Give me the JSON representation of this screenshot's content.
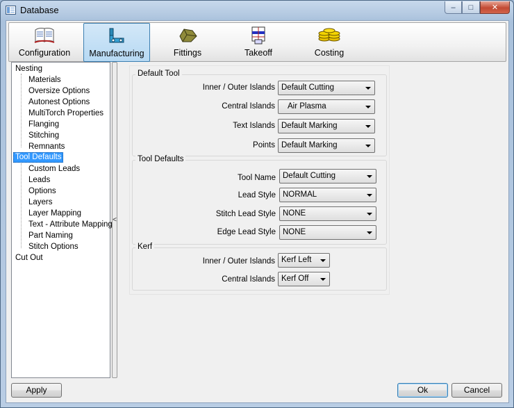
{
  "window": {
    "title": "Database"
  },
  "toolbar": {
    "items": [
      {
        "label": "Configuration",
        "icon": "configuration-icon"
      },
      {
        "label": "Manufacturing",
        "icon": "manufacturing-icon"
      },
      {
        "label": "Fittings",
        "icon": "fittings-icon"
      },
      {
        "label": "Takeoff",
        "icon": "takeoff-icon"
      },
      {
        "label": "Costing",
        "icon": "costing-icon"
      }
    ],
    "active": "Manufacturing"
  },
  "tree": {
    "items": [
      {
        "label": "Nesting"
      },
      {
        "label": "Materials"
      },
      {
        "label": "Oversize Options"
      },
      {
        "label": "Autonest Options"
      },
      {
        "label": "MultiTorch Properties"
      },
      {
        "label": "Flanging"
      },
      {
        "label": "Stitching"
      },
      {
        "label": "Remnants"
      },
      {
        "label": "Tool Defaults"
      },
      {
        "label": "Custom Leads"
      },
      {
        "label": "Leads"
      },
      {
        "label": "Options"
      },
      {
        "label": "Layers"
      },
      {
        "label": "Layer Mapping"
      },
      {
        "label": "Text - Attribute Mapping"
      },
      {
        "label": "Part Naming"
      },
      {
        "label": "Stitch Options"
      },
      {
        "label": "Cut Out"
      }
    ],
    "selected": "Tool Defaults"
  },
  "splitter": {
    "glyph": "<"
  },
  "default_tool": {
    "title": "Default Tool",
    "fields": [
      {
        "label": "Inner / Outer Islands",
        "value": "Default Cutting"
      },
      {
        "label": "Central Islands",
        "value": "Air Plasma"
      },
      {
        "label": "Text Islands",
        "value": "Default Marking"
      },
      {
        "label": "Points",
        "value": "Default Marking"
      }
    ]
  },
  "tool_defaults": {
    "title": "Tool Defaults",
    "fields": [
      {
        "label": "Tool Name",
        "value": "Default Cutting"
      },
      {
        "label": "Lead Style",
        "value": "NORMAL"
      },
      {
        "label": "Stitch Lead Style",
        "value": "NONE"
      },
      {
        "label": "Edge Lead Style",
        "value": "NONE"
      }
    ]
  },
  "kerf": {
    "title": "Kerf",
    "fields": [
      {
        "label": "Inner / Outer Islands",
        "value": "Kerf Left"
      },
      {
        "label": "Central Islands",
        "value": "Kerf Off"
      }
    ]
  },
  "buttons": {
    "apply": "Apply",
    "ok": "Ok",
    "cancel": "Cancel"
  }
}
